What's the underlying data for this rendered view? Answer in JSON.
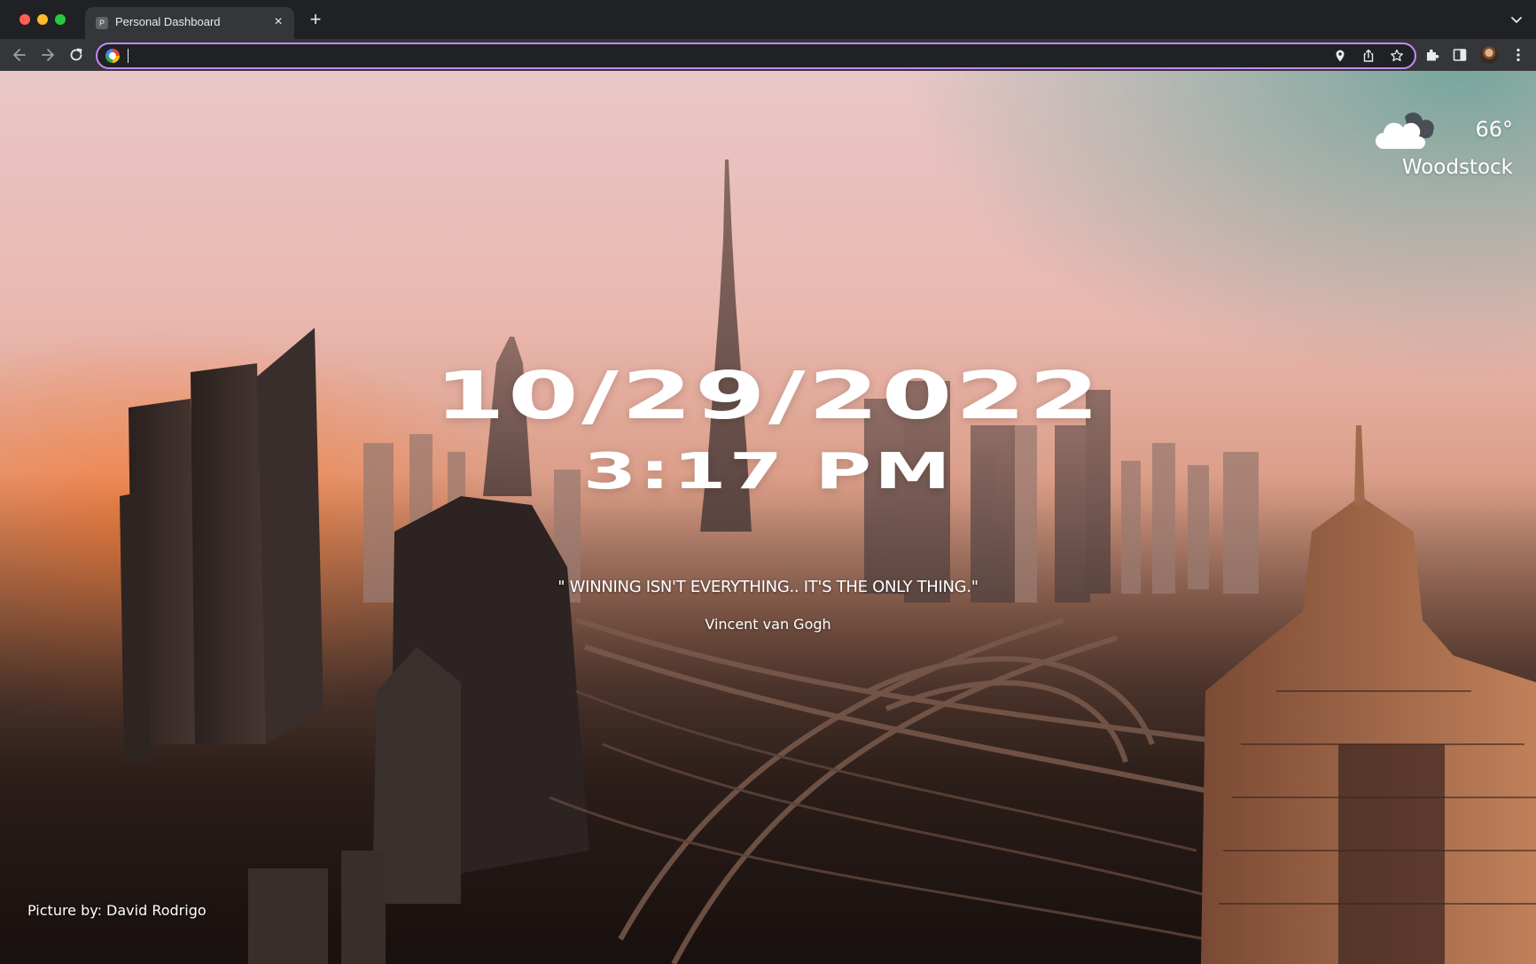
{
  "browser": {
    "tab": {
      "title": "Personal Dashboard",
      "favicon_letter": "P",
      "close_label": "×"
    },
    "new_tab_label": "+",
    "address_bar": {
      "value": "",
      "placeholder": ""
    },
    "icons": {
      "back": "arrow-left-icon",
      "forward": "arrow-right-icon",
      "reload": "reload-icon",
      "location": "location-pin-icon",
      "share": "share-icon",
      "bookmark": "star-icon",
      "extensions": "puzzle-icon",
      "side_panel": "side-panel-icon",
      "menu": "kebab-menu-icon"
    },
    "colors": {
      "chrome_dark": "#202124",
      "toolbar": "#35363a",
      "omnibox_focus": "#c58af9"
    }
  },
  "dashboard": {
    "weather": {
      "icon": "cloud-icon",
      "temperature": "66°",
      "location": "Woodstock"
    },
    "date": "10/29/2022",
    "time": "3:17 PM",
    "quote": {
      "text": "\" WINNING ISN'T EVERYTHING.. IT'S THE ONLY THING.\"",
      "author": "Vincent van Gogh"
    },
    "photo_credit": "Picture by: David Rodrigo",
    "colors": {
      "text": "#ffffff"
    }
  }
}
